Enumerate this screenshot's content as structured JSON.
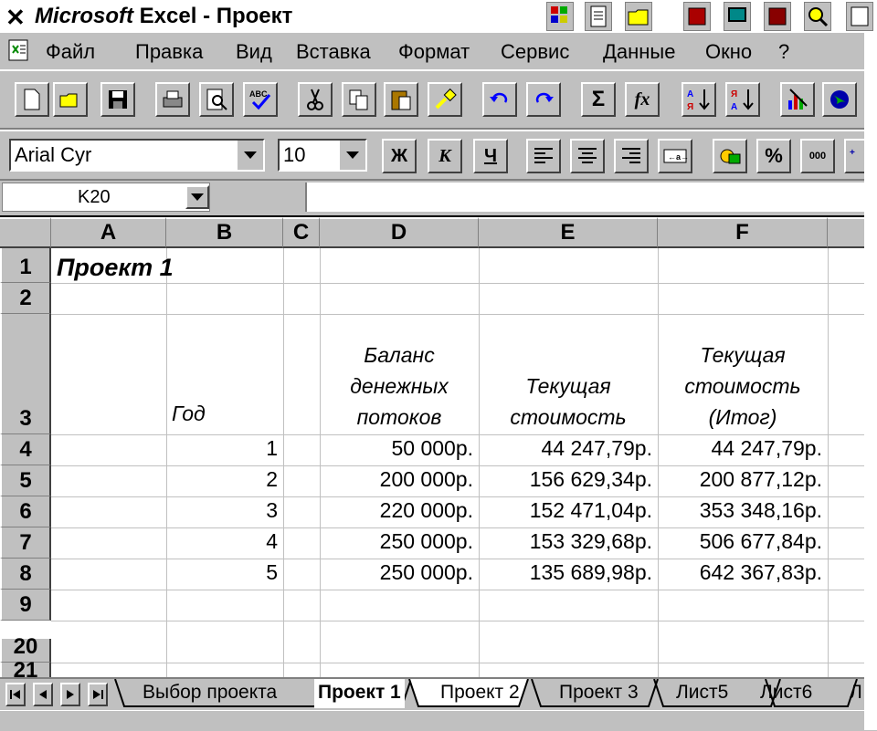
{
  "window": {
    "app_brand": "Microsoft",
    "app_name": "Excel",
    "separator": "-",
    "document": "Проект"
  },
  "menu": [
    "Файл",
    "Правка",
    "Вид",
    "Вставка",
    "Формат",
    "Сервис",
    "Данные",
    "Окно",
    "?"
  ],
  "format_toolbar": {
    "font": "Arial Cyr",
    "size": "10",
    "bold": "Ж",
    "italic": "К",
    "underline": "Ч",
    "percent": "%",
    "thousands": "000"
  },
  "namebox": {
    "value": "K20"
  },
  "columns": [
    "A",
    "B",
    "C",
    "D",
    "E",
    "F"
  ],
  "rows": [
    "1",
    "2",
    "3",
    "4",
    "5",
    "6",
    "7",
    "8",
    "9",
    "20",
    "21"
  ],
  "sheet": {
    "title": "Проект 1",
    "headers": {
      "year": "Год",
      "cash_flow": [
        "Баланс",
        "денежных",
        "потоков"
      ],
      "present_value": [
        "Текущая",
        "стоимость"
      ],
      "present_value_total": [
        "Текущая",
        "стоимость",
        "(Итог)"
      ]
    },
    "data": [
      {
        "year": "1",
        "cash_flow": "50 000р.",
        "pv": "44 247,79р.",
        "pv_total": "44 247,79р."
      },
      {
        "year": "2",
        "cash_flow": "200 000р.",
        "pv": "156 629,34р.",
        "pv_total": "200 877,12р."
      },
      {
        "year": "3",
        "cash_flow": "220 000р.",
        "pv": "152 471,04р.",
        "pv_total": "353 348,16р."
      },
      {
        "year": "4",
        "cash_flow": "250 000р.",
        "pv": "153 329,68р.",
        "pv_total": "506 677,84р."
      },
      {
        "year": "5",
        "cash_flow": "250 000р.",
        "pv": "135 689,98р.",
        "pv_total": "642 367,83р."
      }
    ]
  },
  "tabs": [
    "Выбор проекта",
    "Проект 1",
    "Проект 2",
    "Проект 3",
    "Лист5",
    "Лист6",
    "Л"
  ],
  "active_tab": "Проект 1",
  "colors": {
    "face": "#c0c0c0",
    "grid": "#c0c0c0",
    "shadow": "#808080"
  }
}
